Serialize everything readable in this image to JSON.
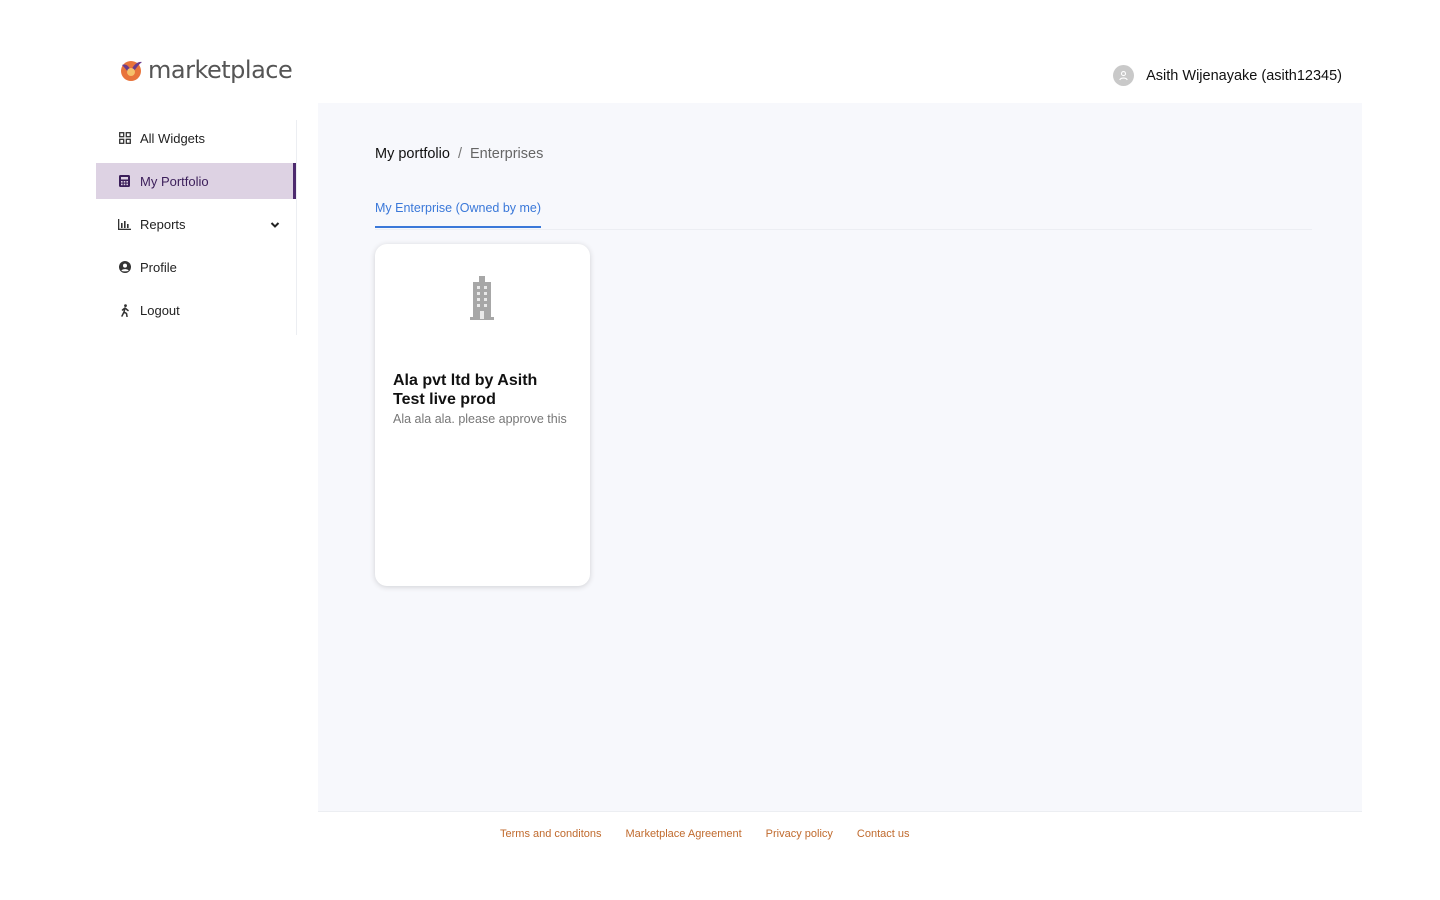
{
  "brand": {
    "name": "marketplace"
  },
  "sidebar": {
    "items": [
      {
        "label": "All Widgets",
        "icon": "grid-icon"
      },
      {
        "label": "My Portfolio",
        "icon": "calculator-icon",
        "active": true
      },
      {
        "label": "Reports",
        "icon": "bar-chart-icon",
        "expandable": true
      },
      {
        "label": "Profile",
        "icon": "user-circle-icon"
      },
      {
        "label": "Logout",
        "icon": "walking-person-icon"
      }
    ]
  },
  "header": {
    "user_name": "Asith Wijenayake (asith12345)"
  },
  "breadcrumb": {
    "current": "My portfolio",
    "separator": "/",
    "page": "Enterprises"
  },
  "tabs": [
    {
      "label": "My Enterprise (Owned by me)",
      "active": true
    }
  ],
  "cards": [
    {
      "title": "Ala pvt ltd by Asith Test live prod",
      "description": "Ala ala ala. please approve this",
      "icon": "building-icon"
    }
  ],
  "footer": {
    "links": [
      "Terms and conditons",
      "Marketplace Agreement",
      "Privacy policy",
      "Contact us"
    ]
  },
  "colors": {
    "active_bg": "#ddd2e3",
    "active_bar": "#4d2a6e",
    "tab_blue": "#3a78d9",
    "footer_link": "#c06a2d",
    "content_bg": "#f7f8fc"
  }
}
